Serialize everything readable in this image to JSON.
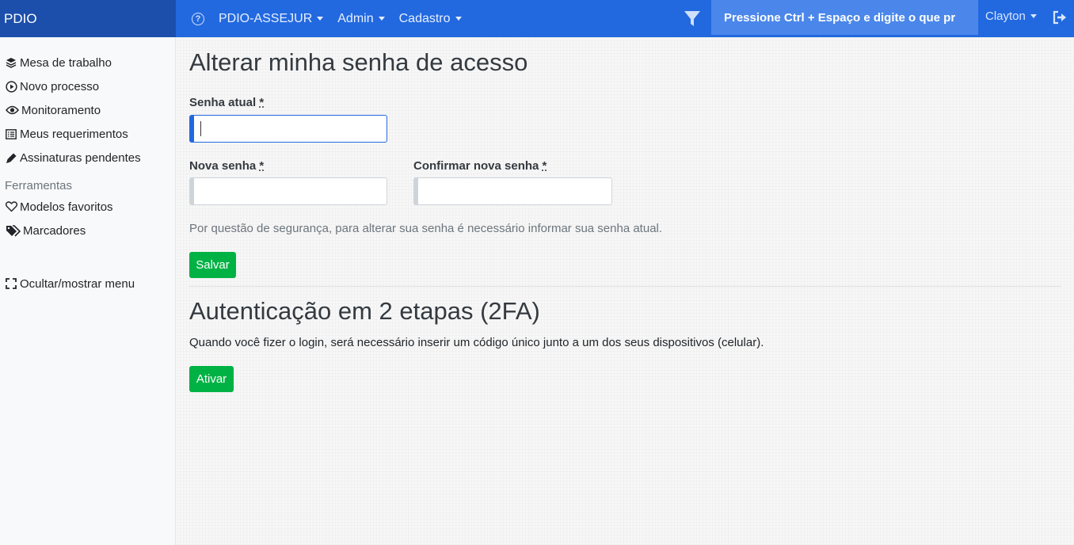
{
  "topbar": {
    "brand": "PDIO",
    "help_icon": "question-circle-icon",
    "menus": [
      {
        "label": "PDIO-ASSEJUR"
      },
      {
        "label": "Admin"
      },
      {
        "label": "Cadastro"
      }
    ],
    "filter_icon": "filter-icon",
    "search_placeholder": "Pressione Ctrl + Espaço e digite o que pr",
    "user": "Clayton",
    "logout_icon": "sign-out-icon",
    "colors": {
      "bar": "#2269e0",
      "brand_bg": "#1c4fab",
      "search_bg": "#4b87ea"
    }
  },
  "sidebar": {
    "items": [
      {
        "label": "Mesa de trabalho",
        "icon": "layers-icon"
      },
      {
        "label": "Novo processo",
        "icon": "play-circle-icon"
      },
      {
        "label": "Monitoramento",
        "icon": "eye-icon"
      },
      {
        "label": "Meus requerimentos",
        "icon": "list-alt-icon"
      },
      {
        "label": "Assinaturas pendentes",
        "icon": "pen-icon"
      }
    ],
    "tools_heading": "Ferramentas",
    "tools": [
      {
        "label": "Modelos favoritos",
        "icon": "heart-icon"
      },
      {
        "label": "Marcadores",
        "icon": "tags-icon"
      }
    ],
    "toggle_label": "Ocultar/mostrar menu",
    "toggle_icon": "expand-icon"
  },
  "password_section": {
    "title": "Alterar minha senha de acesso",
    "current_label": "Senha atual",
    "new_label": "Nova senha",
    "confirm_label": "Confirmar nova senha",
    "required_mark": "*",
    "current_value": "",
    "new_value": "",
    "confirm_value": "",
    "help_text": "Por questão de segurança, para alterar sua senha é necessário informar sua senha atual.",
    "save_label": "Salvar"
  },
  "twofa_section": {
    "title": "Autenticação em 2 etapas (2FA)",
    "description": "Quando você fizer o login, será necessário inserir um código único junto a um dos seus dispositivos (celular).",
    "activate_label": "Ativar"
  },
  "colors": {
    "accent": "#2269e0",
    "success": "#00b244"
  }
}
